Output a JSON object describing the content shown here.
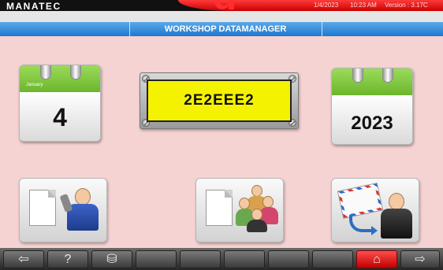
{
  "header": {
    "logo": "MANATEC",
    "date": "1/4/2023",
    "time": "10:23 AM",
    "version": "Version : 3.17C",
    "accent_color": "#d40000"
  },
  "title": "WORKSHOP DATAMANAGER",
  "calendar_day": {
    "month": "January",
    "day": "4"
  },
  "calendar_year": {
    "year": "2023"
  },
  "id_plate": {
    "value": "2E2EEE2"
  },
  "tiles": [
    {
      "icon": "mechanic-document-icon"
    },
    {
      "icon": "users-group-document-icon"
    },
    {
      "icon": "email-contact-icon"
    }
  ],
  "bottom_bar": {
    "buttons": [
      {
        "icon": "arrow-left-icon"
      },
      {
        "icon": "help-icon",
        "glyph": "?"
      },
      {
        "icon": "database-delete-icon"
      },
      {
        "icon": "blank-icon"
      },
      {
        "icon": "blank-icon"
      },
      {
        "icon": "blank-icon"
      },
      {
        "icon": "blank-icon"
      },
      {
        "icon": "blank-icon"
      },
      {
        "icon": "home-icon"
      },
      {
        "icon": "arrow-right-icon"
      }
    ]
  }
}
